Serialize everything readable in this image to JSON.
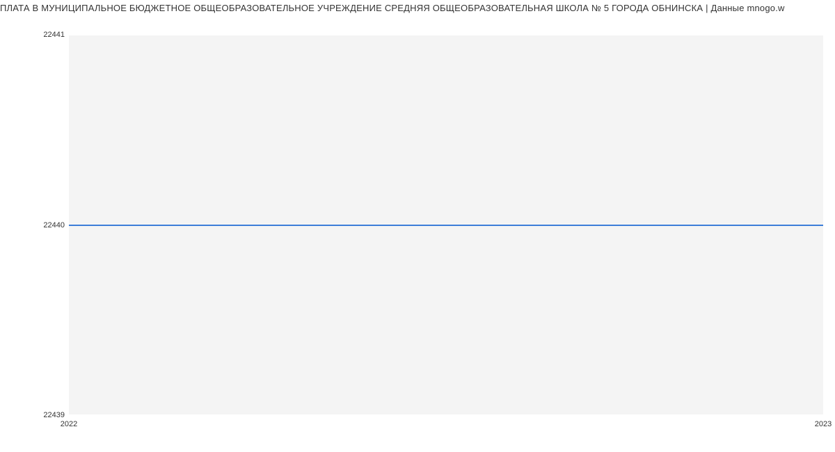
{
  "chart_data": {
    "type": "line",
    "title": "ПЛАТА В МУНИЦИПАЛЬНОЕ БЮДЖЕТНОЕ ОБЩЕОБРАЗОВАТЕЛЬНОЕ УЧРЕЖДЕНИЕ СРЕДНЯЯ ОБЩЕОБРАЗОВАТЕЛЬНАЯ ШКОЛА № 5 ГОРОДА ОБНИНСКА | Данные mnogo.w",
    "x": [
      2022,
      2023
    ],
    "values": [
      22440,
      22440
    ],
    "xlabel": "",
    "ylabel": "",
    "xlim": [
      2022,
      2023
    ],
    "ylim": [
      22439,
      22441
    ],
    "y_ticks": [
      22439,
      22440,
      22441
    ],
    "x_ticks": [
      2022,
      2023
    ],
    "grid": true,
    "series_color": "#3b7dd8"
  },
  "y_tick_labels": {
    "t0": "22439",
    "t1": "22440",
    "t2": "22441"
  },
  "x_tick_labels": {
    "t0": "2022",
    "t1": "2023"
  }
}
